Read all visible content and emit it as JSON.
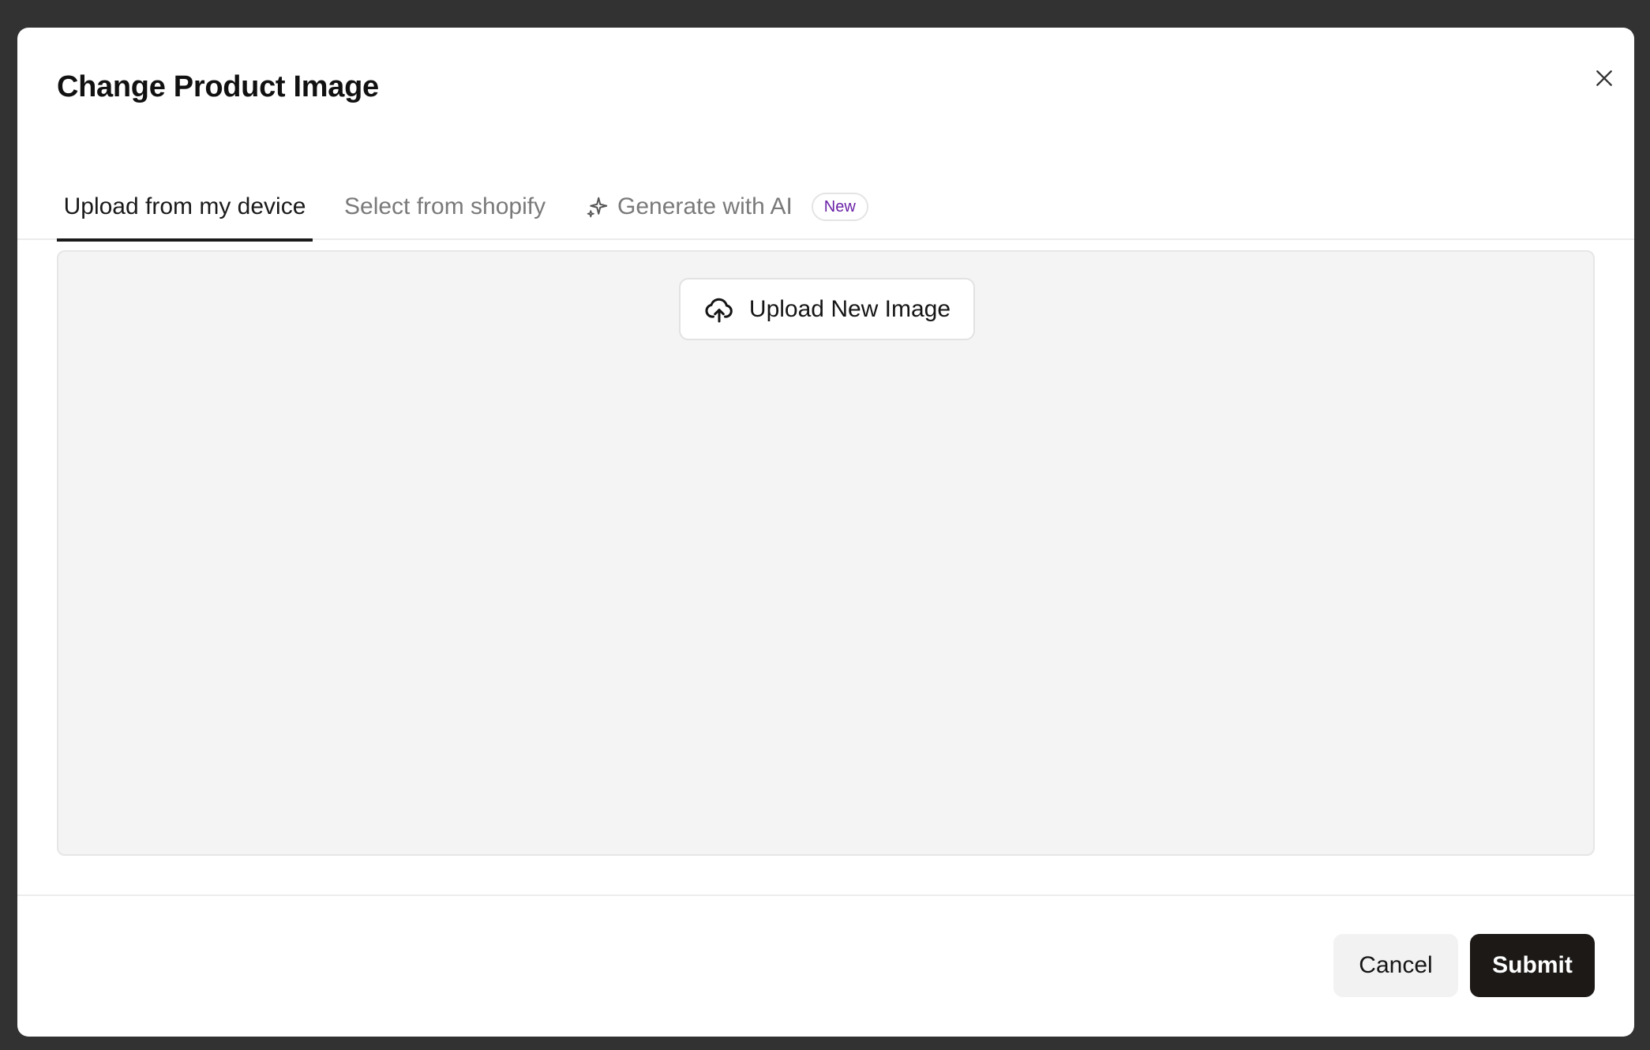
{
  "modal": {
    "title": "Change Product Image"
  },
  "tabs": [
    {
      "label": "Upload from my device",
      "active": true
    },
    {
      "label": "Select from shopify",
      "active": false
    },
    {
      "label": "Generate with AI",
      "active": false,
      "badge": "New",
      "icon": "sparkle-icon"
    }
  ],
  "dropzone": {
    "upload_button_label": "Upload New Image",
    "upload_icon": "cloud-upload-icon"
  },
  "footer": {
    "cancel_label": "Cancel",
    "submit_label": "Submit"
  },
  "colors": {
    "backdrop": "#323232",
    "badge_text": "#6b21a8",
    "submit_bg": "#1c1917",
    "dropzone_bg": "#f4f4f4"
  }
}
